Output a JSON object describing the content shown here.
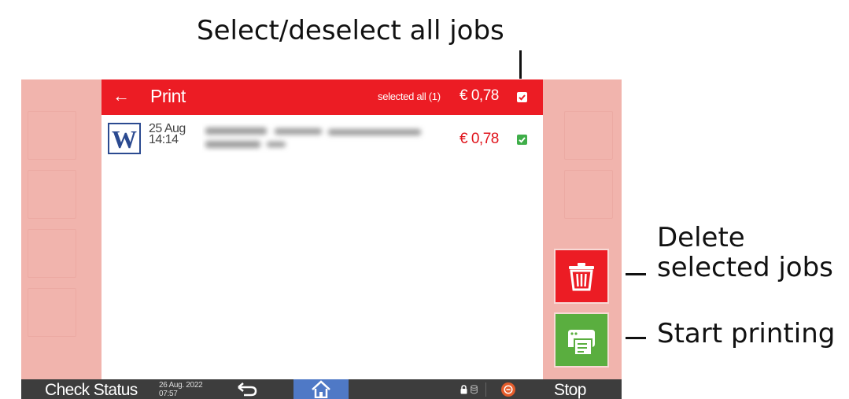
{
  "annotations": {
    "select_all": "Select/deselect all jobs",
    "delete_line1": "Delete",
    "delete_line2": "selected jobs",
    "start": "Start printing"
  },
  "header": {
    "back_icon": "arrow-left-icon",
    "title": "Print",
    "selected_all": "selected all (1)",
    "total": "€ 0,78",
    "select_all_checked": true
  },
  "jobs": [
    {
      "type_icon": "word-document-icon",
      "type_letter": "W",
      "date": "25 Aug",
      "time": "14:14",
      "price": "€ 0,78",
      "checked": true
    }
  ],
  "actions": {
    "delete_icon": "trash-icon",
    "print_icon": "printer-icon"
  },
  "statusbar": {
    "check_status": "Check Status",
    "date": "26 Aug. 2022",
    "time": "07:57",
    "back_icon": "return-arrow-icon",
    "home_icon": "home-icon",
    "lock_icon": "lock-icon",
    "storage_icon": "storage-icon",
    "stop_icon": "stop-icon",
    "stop": "Stop"
  },
  "colors": {
    "header_red": "#ec1c24",
    "price_red": "#e0141c",
    "check_green": "#3fae49",
    "print_green": "#5aae3f",
    "home_blue": "#4f79c6",
    "overlay_pink": "#f1b4ad",
    "statusbar_gray": "#3d3d3d"
  }
}
